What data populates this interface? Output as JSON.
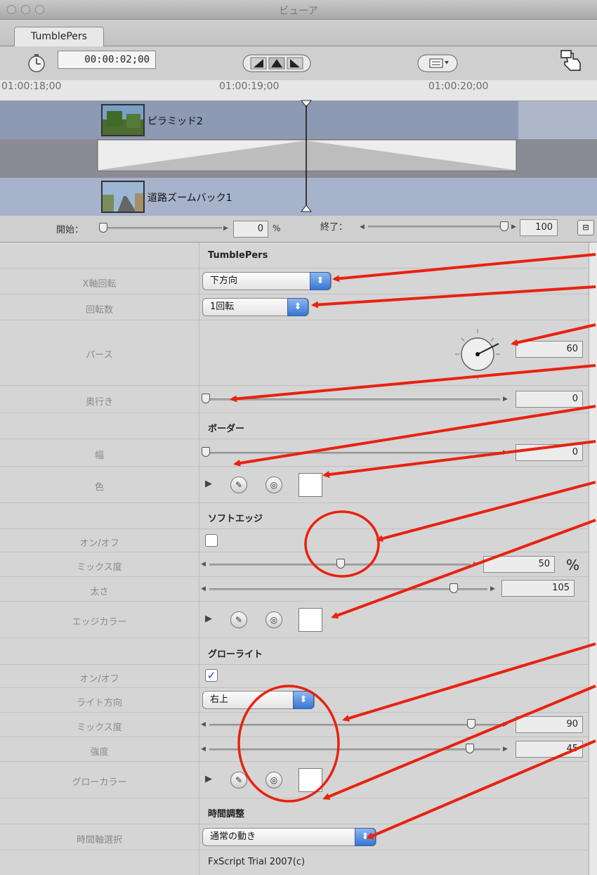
{
  "window": {
    "title": "ビューア",
    "tab_label": "TumblePers"
  },
  "toolbar": {
    "timecode": "00:00:02;00"
  },
  "ruler": {
    "t1": "01:00:18;00",
    "t2": "01:00:19;00",
    "t3": "01:00:20;00"
  },
  "tracks": {
    "clip_a": "ピラミッド2",
    "clip_b": "道路ズームバック1"
  },
  "transition_range": {
    "start_label": "開始：",
    "start_value": "0",
    "start_unit": "%",
    "end_label": "終了：",
    "end_value": "100"
  },
  "params": {
    "effect_title": "TumblePers",
    "x_rotation": {
      "label": "X軸回転",
      "value": "下方向"
    },
    "rotations": {
      "label": "回転数",
      "value": "1回転"
    },
    "perspective": {
      "label": "パース",
      "value": "60"
    },
    "depth": {
      "label": "奥行き",
      "value": "0"
    },
    "border_section": "ボーダー",
    "border_width": {
      "label": "幅",
      "value": "0"
    },
    "border_color": {
      "label": "色"
    },
    "soft_edge_section": "ソフトエッジ",
    "soft_onoff": {
      "label": "オン/オフ",
      "checked": false
    },
    "soft_mix": {
      "label": "ミックス度",
      "value": "50",
      "unit": "%"
    },
    "soft_thickness": {
      "label": "太さ",
      "value": "105"
    },
    "edge_color": {
      "label": "エッジカラー"
    },
    "glow_section": "グローライト",
    "glow_onoff": {
      "label": "オン/オフ",
      "checked": true
    },
    "light_direction": {
      "label": "ライト方向",
      "value": "右上"
    },
    "glow_mix": {
      "label": "ミックス度",
      "value": "90"
    },
    "glow_strength": {
      "label": "強度",
      "value": "45"
    },
    "glow_color": {
      "label": "グローカラー"
    },
    "time_section": "時間調整",
    "time_axis": {
      "label": "時間軸選択",
      "value": "通常の動き"
    },
    "footer": "FxScript Trial 2007(c)"
  },
  "colors": {
    "annotation": "#e8220f",
    "popup_accent": "#3577d4"
  }
}
